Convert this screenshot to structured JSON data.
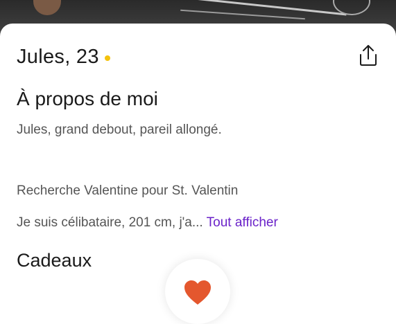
{
  "profile": {
    "name_age": "Jules, 23",
    "online_color": "#f4c20d"
  },
  "share": {
    "icon": "share-icon"
  },
  "about": {
    "title": "À propos de moi",
    "bio": "Jules, grand debout, pareil allongé.",
    "prompt": "Recherche Valentine pour St. Valentin",
    "snippet": "Je suis célibataire, 201 cm, j'a...",
    "see_all_label": "Tout afficher",
    "see_all_color": "#6a22c9"
  },
  "gifts": {
    "title": "Cadeaux",
    "icon": "heart-icon",
    "icon_color": "#e4572e"
  }
}
